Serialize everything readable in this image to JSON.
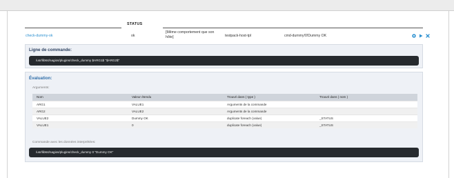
{
  "header": {
    "status_label": "STATUS"
  },
  "service_row": {
    "name": "check-dummy-ok",
    "status": "ok",
    "comment": "[Même comportement que son hôte]",
    "template": "testpack-host-tpl",
    "command": "cmd-dummy!0!Dummy OK",
    "actions": [
      {
        "icon": "gear-icon"
      },
      {
        "icon": "play-icon"
      },
      {
        "icon": "close-icon"
      }
    ]
  },
  "command_line": {
    "title": "Ligne de commande:",
    "value": "/usr/lib64/nagios/plugins/check_dummy $ARG1$ \"$ARG2$\""
  },
  "evaluation": {
    "title": "Évaluation:",
    "arguments_label": "Arguments:",
    "columns": [
      "Nom",
      "Valeur étendu",
      "Trouvé dans ( type )",
      "Trouvé dans ( nom )"
    ],
    "rows": [
      [
        "ARG1",
        "VALUE1",
        "Arguments de la commande",
        ""
      ],
      [
        "ARG2",
        "VALUE2",
        "Arguments de la commande",
        ""
      ],
      [
        "VALUE2",
        "Dummy OK",
        "duplicate foreach (value)",
        "_STATUS"
      ],
      [
        "VALUE1",
        "0",
        "duplicate foreach (value)",
        "_STATUS"
      ]
    ],
    "interpreted_label": "Commande avec les données interprétées:",
    "interpreted_value": "/usr/lib64/nagios/plugins/check_dummy 0 \"Dummy OK\""
  },
  "colors": {
    "link": "#2a8fd0",
    "action_icon": "#2a8fd0",
    "panel_bg": "#eef1f6",
    "command_bg": "#262a2e"
  }
}
